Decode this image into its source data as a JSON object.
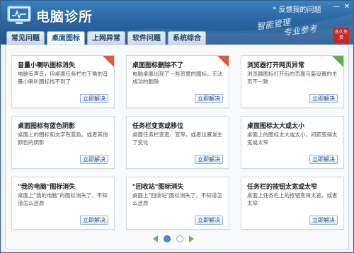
{
  "app": {
    "title": "电脑诊所"
  },
  "header": {
    "feedback_label": "反馈我的问题",
    "slogan_line1": "智能管理",
    "slogan_line2": "专业参考",
    "stamp_text": "永久免费"
  },
  "tabs": [
    {
      "label": "常见问题",
      "active": false
    },
    {
      "label": "桌面图标",
      "active": true
    },
    {
      "label": "上网异常",
      "active": false
    },
    {
      "label": "软件问题",
      "active": false
    },
    {
      "label": "系统综合",
      "active": false
    }
  ],
  "button_label": "立即解决",
  "cards": [
    {
      "title": "音量小喇叭图标消失",
      "desc": "电脑有声音，但桌面任务栏右下角的音量小喇叭图标找不到了",
      "badge": "hot"
    },
    {
      "title": "桌面图标删除不了",
      "desc": "电脑桌面出现了一些恶意的图标，无法成功的删除",
      "badge": "hot"
    },
    {
      "title": "浏览器打开网页异常",
      "desc": "浏览器图标打开后的页面与装设置的主页不一致",
      "badge": "new"
    },
    {
      "title": "桌面图标有蓝色阴影",
      "desc": "桌面上的图标和文字有蓝色，或者其他颜色的阴影",
      "badge": ""
    },
    {
      "title": "任务栏变宽或移位",
      "desc": "桌面任务栏变宽、变窄，或者位置发生了变化",
      "badge": ""
    },
    {
      "title": "桌面图标太大或太小",
      "desc": "桌面上的图标太大或太小，间距变得太宽或太窄",
      "badge": ""
    },
    {
      "title": "\"我的电脑\"图标消失",
      "desc": "桌面上\"我的电脑\"的图标消失了，不知道怎么还原",
      "badge": ""
    },
    {
      "title": "\"回收站\"图标消失",
      "desc": "桌面上\"回收站\"图标消失了，不知道怎么还原",
      "badge": ""
    },
    {
      "title": "任务栏的按钮太宽或太窄",
      "desc": "桌面上任务栏上的按钮变得太宽，或者太窄",
      "badge": ""
    }
  ],
  "pager": {
    "current": 1,
    "total": 2
  },
  "colors": {
    "header": "#2a66a3",
    "hot_badge": "#e4573c",
    "new_badge": "#5ab04a",
    "pager_arrow": "#6fb64e"
  }
}
